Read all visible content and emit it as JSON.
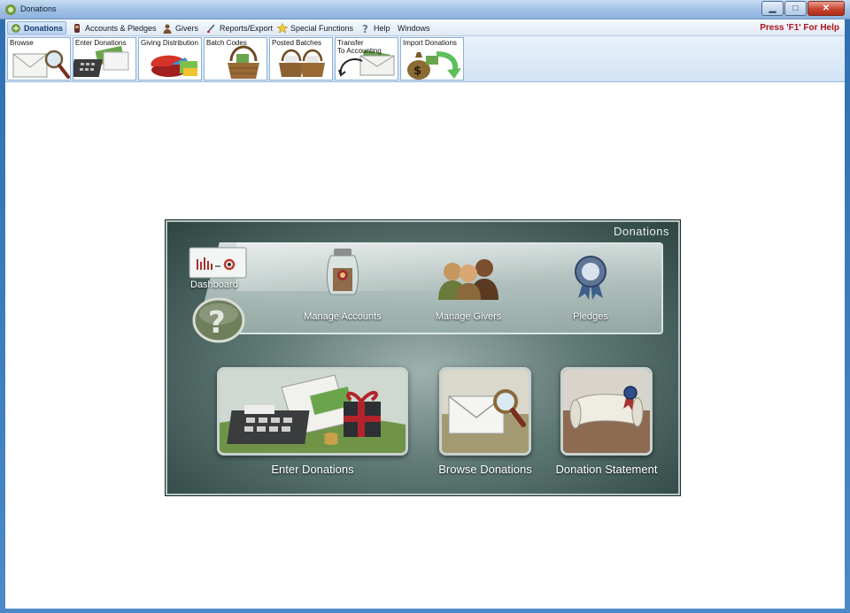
{
  "window": {
    "title": "Donations",
    "controls": {
      "minimize": "▁",
      "maximize": "□",
      "close": "✕"
    }
  },
  "menu": {
    "items": [
      {
        "label": "Donations",
        "icon": "donations-icon",
        "active": true
      },
      {
        "label": "Accounts & Pledges",
        "icon": "accounts-icon"
      },
      {
        "label": "Givers",
        "icon": "givers-icon"
      },
      {
        "label": "Reports/Export",
        "icon": "reports-icon"
      },
      {
        "label": "Special Functions",
        "icon": "star-icon"
      },
      {
        "label": "Help",
        "icon": "help-icon"
      },
      {
        "label": "Windows",
        "icon": ""
      }
    ],
    "help_hint": "Press 'F1' For Help"
  },
  "toolbar": {
    "buttons": [
      {
        "label": "Browse",
        "icon": "envelope-magnifier-icon"
      },
      {
        "label": "Enter Donations",
        "icon": "calculator-money-icon"
      },
      {
        "label": "Giving Distribution",
        "icon": "pie-chart-icon"
      },
      {
        "label": "Batch Codes",
        "icon": "basket-icon"
      },
      {
        "label": "Posted Batches",
        "icon": "baskets-icon"
      },
      {
        "label": "Transfer\nTo Accounting",
        "icon": "transfer-envelope-icon"
      },
      {
        "label": "Import Donations",
        "icon": "money-bag-arrow-icon"
      }
    ]
  },
  "dashboard": {
    "title": "Donations",
    "dashboard_label": "Dashboard",
    "top_items": [
      {
        "label": "Manage Accounts",
        "icon": "jar-icon"
      },
      {
        "label": "Manage Givers",
        "icon": "people-icon"
      },
      {
        "label": "Pledges",
        "icon": "ribbon-seal-icon"
      }
    ],
    "tiles": [
      {
        "label": "Enter Donations",
        "icon": "calculator-gift-icon"
      },
      {
        "label": "Browse Donations",
        "icon": "envelope-magnifier-icon"
      },
      {
        "label": "Donation Statement",
        "icon": "scroll-seal-icon"
      }
    ],
    "help_icon": "question-icon"
  }
}
